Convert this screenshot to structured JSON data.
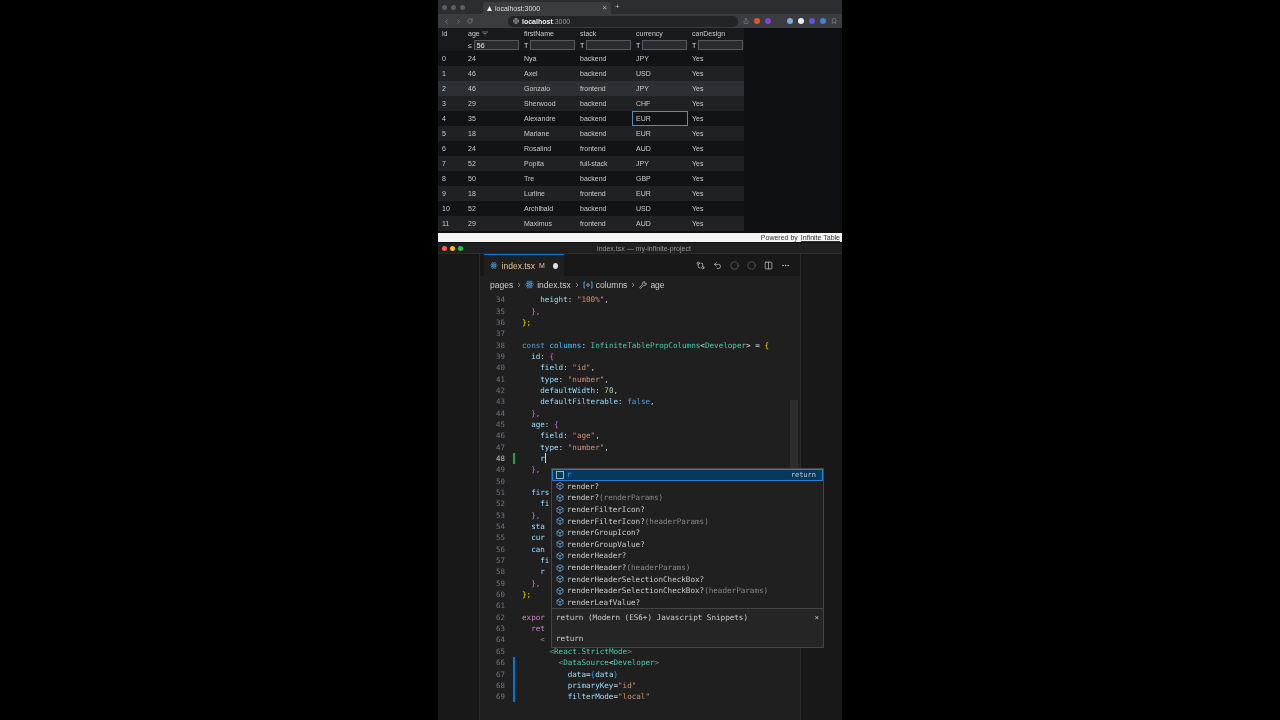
{
  "browser": {
    "tab_title": "localhost:3000",
    "tab_close": "×",
    "new_tab": "+",
    "url_host": "localhost",
    "url_port": ":3000",
    "columns": [
      {
        "label": "id",
        "sorted": false,
        "focused": false
      },
      {
        "label": "age",
        "operator": "≤",
        "value": "56",
        "sorted": true,
        "focused": false
      },
      {
        "label": "firstName",
        "operator": "T",
        "sorted": false,
        "focused": false
      },
      {
        "label": "stack",
        "operator": "T",
        "sorted": false,
        "focused": false
      },
      {
        "label": "currency",
        "operator": "T",
        "sorted": false,
        "focused": true
      },
      {
        "label": "canDesign",
        "operator": "T",
        "sorted": false,
        "focused": false
      }
    ],
    "rows": [
      {
        "cells": [
          "0",
          "24",
          "Nya",
          "backend",
          "JPY",
          "Yes"
        ],
        "hovered": false,
        "focused": false
      },
      {
        "cells": [
          "1",
          "46",
          "Axel",
          "backend",
          "USD",
          "Yes"
        ],
        "hovered": false,
        "focused": false
      },
      {
        "cells": [
          "2",
          "46",
          "Gonzalo",
          "frontend",
          "JPY",
          "Yes"
        ],
        "hovered": true,
        "focused": false
      },
      {
        "cells": [
          "3",
          "29",
          "Sherwood",
          "backend",
          "CHF",
          "Yes"
        ],
        "hovered": false,
        "focused": false
      },
      {
        "cells": [
          "4",
          "35",
          "Alexandre",
          "backend",
          "EUR",
          "Yes"
        ],
        "hovered": false,
        "focused": true
      },
      {
        "cells": [
          "5",
          "18",
          "Mariane",
          "backend",
          "EUR",
          "Yes"
        ],
        "hovered": false,
        "focused": false
      },
      {
        "cells": [
          "6",
          "24",
          "Rosalind",
          "frontend",
          "AUD",
          "Yes"
        ],
        "hovered": false,
        "focused": false
      },
      {
        "cells": [
          "7",
          "52",
          "Popita",
          "full-stack",
          "JPY",
          "Yes"
        ],
        "hovered": false,
        "focused": false
      },
      {
        "cells": [
          "8",
          "50",
          "Tre",
          "backend",
          "GBP",
          "Yes"
        ],
        "hovered": false,
        "focused": false
      },
      {
        "cells": [
          "9",
          "18",
          "Lurline",
          "frontend",
          "EUR",
          "Yes"
        ],
        "hovered": false,
        "focused": false
      },
      {
        "cells": [
          "10",
          "52",
          "Archibald",
          "backend",
          "USD",
          "Yes"
        ],
        "hovered": false,
        "focused": false
      },
      {
        "cells": [
          "11",
          "29",
          "Maximus",
          "frontend",
          "AUD",
          "Yes"
        ],
        "hovered": false,
        "focused": false
      }
    ],
    "footer_text": "Powered by",
    "footer_link": "Infinite Table"
  },
  "editor": {
    "window_title": "index.tsx — my-infinite-project",
    "tab": {
      "name": "index.tsx",
      "status": "M",
      "dirty": true
    },
    "breadcrumb": [
      {
        "text": "pages",
        "kind": "folder"
      },
      {
        "text": "index.tsx",
        "kind": "react"
      },
      {
        "text": "columns",
        "kind": "variable"
      },
      {
        "text": "age",
        "kind": "property"
      }
    ],
    "lines": [
      {
        "number": "34",
        "kind": "plain",
        "tokens": [
          {
            "text": "    height",
            "kind": "v"
          },
          {
            "text": ": ",
            "kind": "p"
          },
          {
            "text": "\"100%\"",
            "kind": "s"
          },
          {
            "text": ",",
            "kind": "p"
          }
        ]
      },
      {
        "number": "35",
        "kind": "plain",
        "tokens": [
          {
            "text": "  },",
            "kind": "b2"
          }
        ]
      },
      {
        "number": "36",
        "kind": "plain",
        "tokens": [
          {
            "text": "};",
            "kind": "b1"
          }
        ]
      },
      {
        "number": "37",
        "kind": "plain"
      },
      {
        "number": "38",
        "kind": "plain",
        "tokens": [
          {
            "text": "const ",
            "kind": "k"
          },
          {
            "text": "columns",
            "kind": "c"
          },
          {
            "text": ": ",
            "kind": "p"
          },
          {
            "text": "InfiniteTablePropColumns",
            "kind": "t"
          },
          {
            "text": "<",
            "kind": "p"
          },
          {
            "text": "Developer",
            "kind": "t"
          },
          {
            "text": "> = ",
            "kind": "p"
          },
          {
            "text": "{",
            "kind": "b1"
          }
        ]
      },
      {
        "number": "39",
        "kind": "plain",
        "tokens": [
          {
            "text": "  id",
            "kind": "v"
          },
          {
            "text": ": ",
            "kind": "p"
          },
          {
            "text": "{",
            "kind": "b2"
          }
        ]
      },
      {
        "number": "40",
        "kind": "plain",
        "tokens": [
          {
            "text": "    field",
            "kind": "v"
          },
          {
            "text": ": ",
            "kind": "p"
          },
          {
            "text": "\"id\"",
            "kind": "s"
          },
          {
            "text": ",",
            "kind": "p"
          }
        ]
      },
      {
        "number": "41",
        "kind": "plain",
        "tokens": [
          {
            "text": "    type",
            "kind": "v"
          },
          {
            "text": ": ",
            "kind": "p"
          },
          {
            "text": "\"number\"",
            "kind": "s"
          },
          {
            "text": ",",
            "kind": "p"
          }
        ]
      },
      {
        "number": "42",
        "kind": "plain",
        "tokens": [
          {
            "text": "    defaultWidth",
            "kind": "v"
          },
          {
            "text": ": ",
            "kind": "p"
          },
          {
            "text": "70",
            "kind": "n"
          },
          {
            "text": ",",
            "kind": "p"
          }
        ]
      },
      {
        "number": "43",
        "kind": "plain",
        "tokens": [
          {
            "text": "    defaultFilterable",
            "kind": "v"
          },
          {
            "text": ": ",
            "kind": "p"
          },
          {
            "text": "false",
            "kind": "k"
          },
          {
            "text": ",",
            "kind": "p"
          }
        ]
      },
      {
        "number": "44",
        "kind": "plain",
        "tokens": [
          {
            "text": "  },",
            "kind": "b2"
          }
        ]
      },
      {
        "number": "45",
        "kind": "plain",
        "tokens": [
          {
            "text": "  age",
            "kind": "v"
          },
          {
            "text": ": ",
            "kind": "p"
          },
          {
            "text": "{",
            "kind": "b2"
          }
        ]
      },
      {
        "number": "46",
        "kind": "plain",
        "tokens": [
          {
            "text": "    field",
            "kind": "v"
          },
          {
            "text": ": ",
            "kind": "p"
          },
          {
            "text": "\"age\"",
            "kind": "s"
          },
          {
            "text": ",",
            "kind": "p"
          }
        ]
      },
      {
        "number": "47",
        "kind": "plain",
        "tokens": [
          {
            "text": "    type",
            "kind": "v"
          },
          {
            "text": ": ",
            "kind": "p"
          },
          {
            "text": "\"number\"",
            "kind": "s"
          },
          {
            "text": ",",
            "kind": "p"
          }
        ]
      },
      {
        "number": "48",
        "kind": "added",
        "tokens": [
          {
            "text": "    r",
            "kind": "v"
          }
        ],
        "cursor": true
      },
      {
        "number": "49",
        "kind": "plain",
        "tokens": [
          {
            "text": "  },",
            "kind": "b2"
          }
        ]
      },
      {
        "number": "50",
        "kind": "plain"
      },
      {
        "number": "51",
        "kind": "plain",
        "tokens": [
          {
            "text": "  firs",
            "kind": "v"
          }
        ]
      },
      {
        "number": "52",
        "kind": "plain",
        "tokens": [
          {
            "text": "    fi",
            "kind": "v"
          }
        ]
      },
      {
        "number": "53",
        "kind": "plain",
        "tokens": [
          {
            "text": "  },",
            "kind": "b2"
          }
        ]
      },
      {
        "number": "54",
        "kind": "plain",
        "tokens": [
          {
            "text": "  sta",
            "kind": "v"
          }
        ]
      },
      {
        "number": "55",
        "kind": "plain",
        "tokens": [
          {
            "text": "  cur",
            "kind": "v"
          }
        ]
      },
      {
        "number": "56",
        "kind": "plain",
        "tokens": [
          {
            "text": "  can",
            "kind": "v"
          }
        ]
      },
      {
        "number": "57",
        "kind": "plain",
        "tokens": [
          {
            "text": "    fi",
            "kind": "v"
          }
        ]
      },
      {
        "number": "58",
        "kind": "plain",
        "tokens": [
          {
            "text": "    r",
            "kind": "v"
          }
        ]
      },
      {
        "number": "59",
        "kind": "plain",
        "tokens": [
          {
            "text": "  },",
            "kind": "b2"
          }
        ]
      },
      {
        "number": "60",
        "kind": "plain",
        "tokens": [
          {
            "text": "};",
            "kind": "b1"
          }
        ]
      },
      {
        "number": "61",
        "kind": "plain"
      },
      {
        "number": "62",
        "kind": "plain",
        "tokens": [
          {
            "text": "expor",
            "kind": "c2"
          }
        ]
      },
      {
        "number": "63",
        "kind": "plain",
        "tokens": [
          {
            "text": "  ret",
            "kind": "c2"
          }
        ]
      },
      {
        "number": "64",
        "kind": "plain",
        "tokens": [
          {
            "text": "    <",
            "kind": "g"
          }
        ]
      },
      {
        "number": "65",
        "kind": "plain",
        "tokens": [
          {
            "text": "      <",
            "kind": "g"
          },
          {
            "text": "React.StrictMode",
            "kind": "t"
          },
          {
            "text": ">",
            "kind": "g"
          }
        ]
      },
      {
        "number": "66",
        "kind": "modified",
        "tokens": [
          {
            "text": "        <",
            "kind": "g"
          },
          {
            "text": "DataSource",
            "kind": "t"
          },
          {
            "text": "<",
            "kind": "p"
          },
          {
            "text": "Developer",
            "kind": "t"
          },
          {
            "text": ">",
            "kind": "g"
          }
        ]
      },
      {
        "number": "67",
        "kind": "modified",
        "tokens": [
          {
            "text": "          data",
            "kind": "v"
          },
          {
            "text": "=",
            "kind": "p"
          },
          {
            "text": "{",
            "kind": "b3"
          },
          {
            "text": "data",
            "kind": "v"
          },
          {
            "text": "}",
            "kind": "b3"
          }
        ]
      },
      {
        "number": "68",
        "kind": "modified",
        "tokens": [
          {
            "text": "          primaryKey",
            "kind": "v"
          },
          {
            "text": "=",
            "kind": "p"
          },
          {
            "text": "\"id\"",
            "kind": "s"
          }
        ]
      },
      {
        "number": "69",
        "kind": "modified",
        "tokens": [
          {
            "text": "          filterMode",
            "kind": "v"
          },
          {
            "text": "=",
            "kind": "p"
          },
          {
            "text": "\"local\"",
            "kind": "s"
          }
        ]
      }
    ],
    "suggestions": [
      {
        "label": "r",
        "kind": "snippet",
        "selected": true,
        "hint": "return"
      },
      {
        "label": "render?",
        "kind": "property",
        "selected": false
      },
      {
        "label": "render?",
        "params": "(renderParams)",
        "kind": "property",
        "selected": false
      },
      {
        "label": "renderFilterIcon?",
        "kind": "property",
        "selected": false
      },
      {
        "label": "renderFilterIcon?",
        "params": "(headerParams)",
        "kind": "property",
        "selected": false
      },
      {
        "label": "renderGroupIcon?",
        "kind": "property",
        "selected": false
      },
      {
        "label": "renderGroupValue?",
        "kind": "property",
        "selected": false
      },
      {
        "label": "renderHeader?",
        "kind": "property",
        "selected": false
      },
      {
        "label": "renderHeader?",
        "params": "(headerParams)",
        "kind": "property",
        "selected": false
      },
      {
        "label": "renderHeaderSelectionCheckBox?",
        "kind": "property",
        "selected": false
      },
      {
        "label": "renderHeaderSelectionCheckBox?",
        "params": "(headerParams)",
        "kind": "property",
        "selected": false
      },
      {
        "label": "renderLeafValue?",
        "kind": "property",
        "selected": false
      }
    ],
    "detail": {
      "title": "return (Modern (ES6+) Javascript Snippets)",
      "close": "×",
      "body": "return"
    }
  }
}
